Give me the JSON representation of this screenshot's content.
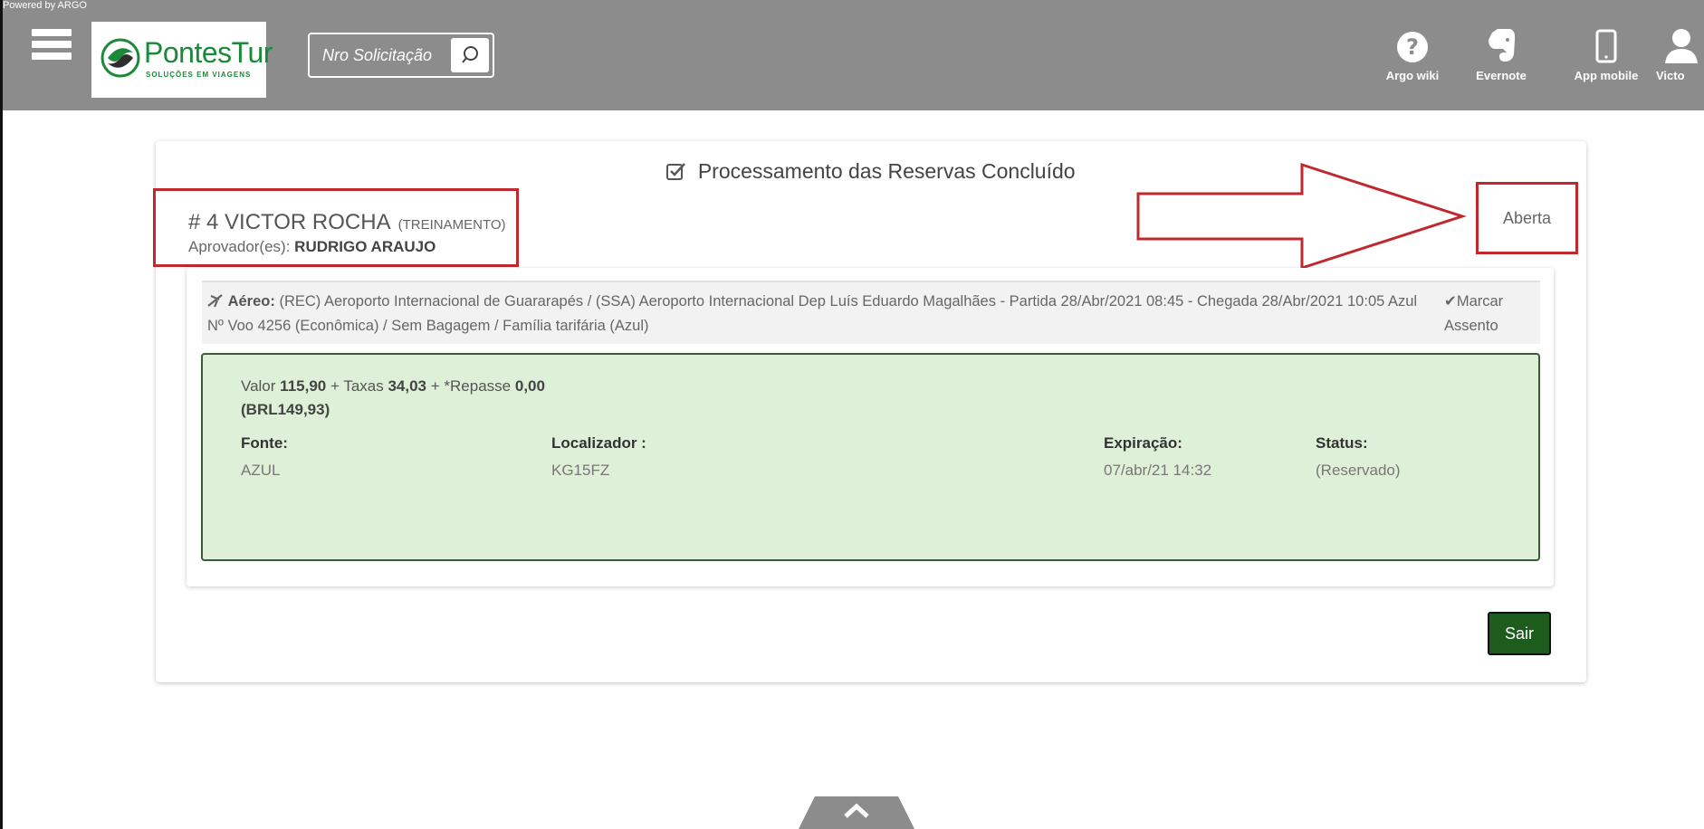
{
  "header": {
    "powered_by": "Powered by ARGO",
    "logo_brand": "PontesTur",
    "logo_tagline": "SOLUÇÕES EM VIAGENS",
    "search_placeholder": "Nro Solicitação",
    "icons": [
      {
        "icon": "question-icon",
        "label": "Argo wiki"
      },
      {
        "icon": "evernote-icon",
        "label": "Evernote"
      },
      {
        "icon": "mobile-icon",
        "label": "App mobile"
      },
      {
        "icon": "user-icon",
        "label": "Victo"
      }
    ]
  },
  "page": {
    "title": "Processamento das Reservas Concluído",
    "request_number": "# 4 VICTOR ROCHA",
    "request_tag": "(TREINAMENTO)",
    "approver_label": "Aprovador(es):",
    "approver_name": "RUDRIGO ARAUJO",
    "status": "Aberta"
  },
  "flight": {
    "type_label": "Aéreo:",
    "description": "(REC) Aeroporto Internacional de Guararapés / (SSA) Aeroporto Internacional Dep Luís Eduardo Magalhães - Partida 28/Abr/2021 08:45 - Chegada 28/Abr/2021 10:05 Azul Nº Voo 4256 (Econômica) / Sem Bagagem / Família tarifária (Azul)",
    "action_label": "✔Marcar Assento"
  },
  "booking": {
    "valor_label": "Valor",
    "valor": "115,90",
    "taxas_label": "+ Taxas",
    "taxas": "34,03",
    "repasse_label": "+ *Repasse",
    "repasse": "0,00",
    "total": "(BRL149,93)",
    "fonte_label": "Fonte:",
    "fonte": "AZUL",
    "localizador_label": "Localizador :",
    "localizador": "KG15FZ",
    "expiracao_label": "Expiração:",
    "expiracao": "07/abr/21 14:32",
    "status_label": "Status:",
    "status": "(Reservado)"
  },
  "actions": {
    "sair_label": "Sair"
  },
  "colors": {
    "header_bg": "#8c8c8c",
    "brand_green": "#1a8a3a",
    "booking_bg": "#dff0d8",
    "sair_bg": "#1e5c1e",
    "highlight_red": "#c0282d"
  }
}
